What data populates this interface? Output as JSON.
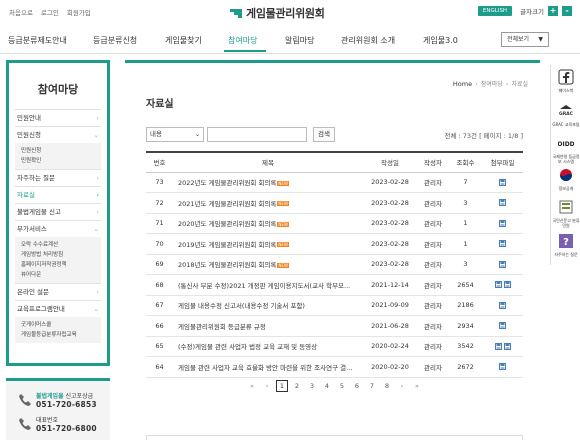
{
  "util": {
    "links": [
      "처음으로",
      "로그인",
      "회원가입"
    ],
    "site_title": "게임물관리위원회",
    "english": "ENGLISH",
    "font_size_label": "글자크기",
    "font_plus": "+",
    "font_minus": "-"
  },
  "gnb": {
    "items": [
      "등급분류제도안내",
      "등급분류신청",
      "게임물찾기",
      "참여마당",
      "알림마당",
      "관리위원회 소개",
      "게임물3.0"
    ],
    "active_index": 3,
    "all_menu": "전체보기"
  },
  "sidebar": {
    "title": "참여마당",
    "items": [
      {
        "label": "민원안내"
      },
      {
        "label": "민원신청"
      },
      {
        "label": "자주하는 질문"
      },
      {
        "label": "자료실"
      },
      {
        "label": "불법게임물 신고"
      },
      {
        "label": "부가서비스"
      },
      {
        "label": "온라인 설문"
      },
      {
        "label": "교육프로그램안내"
      }
    ],
    "sub_civil": [
      "민원신청",
      "민원확인"
    ],
    "sub_extra": [
      "오락 수수료계산",
      "게임방법 처리방침",
      "홈페이지저작권정책",
      "뷰어다운"
    ],
    "sub_edu": [
      "굿게이머스쿨",
      "게임물등급분류자립교육"
    ],
    "active_item": "자료실"
  },
  "contact": {
    "report_label_hl": "불법게임물",
    "report_label_rest": " 신고포상금",
    "report_phone": "051-720-6853",
    "main_label": "대표번호",
    "main_phone": "051-720-6800"
  },
  "main": {
    "breadcrumb": {
      "home": "Home",
      "section": "참여마당",
      "current": "자료실"
    },
    "title": "자료실",
    "search": {
      "select_value": "내용",
      "button": "검색"
    },
    "total": "전체 : 73건 [ 페이지 : 1/8 ]",
    "columns": [
      "번호",
      "제목",
      "작성일",
      "작성자",
      "조회수",
      "첨부파일"
    ],
    "new_badge": "NEW",
    "rows": [
      {
        "no": "73",
        "title": "2022년도 게임물관리위원회 회의록",
        "is_new": true,
        "date": "2023-02-28",
        "author": "관리자",
        "views": "7",
        "files": 1
      },
      {
        "no": "72",
        "title": "2021년도 게임물관리위원회 회의록",
        "is_new": true,
        "date": "2023-02-28",
        "author": "관리자",
        "views": "3",
        "files": 1
      },
      {
        "no": "71",
        "title": "2020년도 게임물관리위원회 회의록",
        "is_new": true,
        "date": "2023-02-28",
        "author": "관리자",
        "views": "1",
        "files": 1
      },
      {
        "no": "70",
        "title": "2019년도 게임물관리위원회 회의록",
        "is_new": true,
        "date": "2023-02-28",
        "author": "관리자",
        "views": "1",
        "files": 1
      },
      {
        "no": "69",
        "title": "2018년도 게임물관리위원회 회의록",
        "is_new": true,
        "date": "2023-02-28",
        "author": "관리자",
        "views": "3",
        "files": 1
      },
      {
        "no": "68",
        "title": "(통신사 부분 수정)2021 개정판 게임이용지도서(교사 학부모...",
        "is_new": false,
        "date": "2021-12-14",
        "author": "관리자",
        "views": "2654",
        "files": 2
      },
      {
        "no": "67",
        "title": "게임물 내용수정 신고서(내용수정 기술서 포함)",
        "is_new": false,
        "date": "2021-09-09",
        "author": "관리자",
        "views": "2186",
        "files": 1
      },
      {
        "no": "66",
        "title": "게임물관리위원회 등급분류 규정",
        "is_new": false,
        "date": "2021-06-28",
        "author": "관리자",
        "views": "2934",
        "files": 1
      },
      {
        "no": "65",
        "title": "(수정)게임물 관련 사업자 법정 교육 교재 및 동영상",
        "is_new": false,
        "date": "2020-02-24",
        "author": "관리자",
        "views": "3542",
        "files": 2
      },
      {
        "no": "64",
        "title": "게임물 관련 사업자 교육 효율화 방안 마련을 위한 조사연구 결...",
        "is_new": false,
        "date": "2020-02-20",
        "author": "관리자",
        "views": "2672",
        "files": 1
      }
    ],
    "pager": {
      "first": "«",
      "prev": "‹",
      "pages": [
        "1",
        "2",
        "3",
        "4",
        "5",
        "6",
        "7",
        "8"
      ],
      "current": "1",
      "next": "›",
      "last": "»"
    }
  },
  "quick": [
    {
      "label": "페이스북",
      "icon": "facebook-icon"
    },
    {
      "label": "GRAC 교육포털",
      "icon": "grac-icon"
    },
    {
      "label": "국제연령 등급정보 시스템",
      "icon": "oidd-icon"
    },
    {
      "label": "정보공개",
      "icon": "open-info-icon"
    },
    {
      "label": "국민신문고 분류민원",
      "icon": "petition-icon"
    },
    {
      "label": "자주하는 질문",
      "icon": "faq-icon"
    }
  ],
  "colors": {
    "accent": "#1d9c8c",
    "new_badge": "#f5821f"
  }
}
